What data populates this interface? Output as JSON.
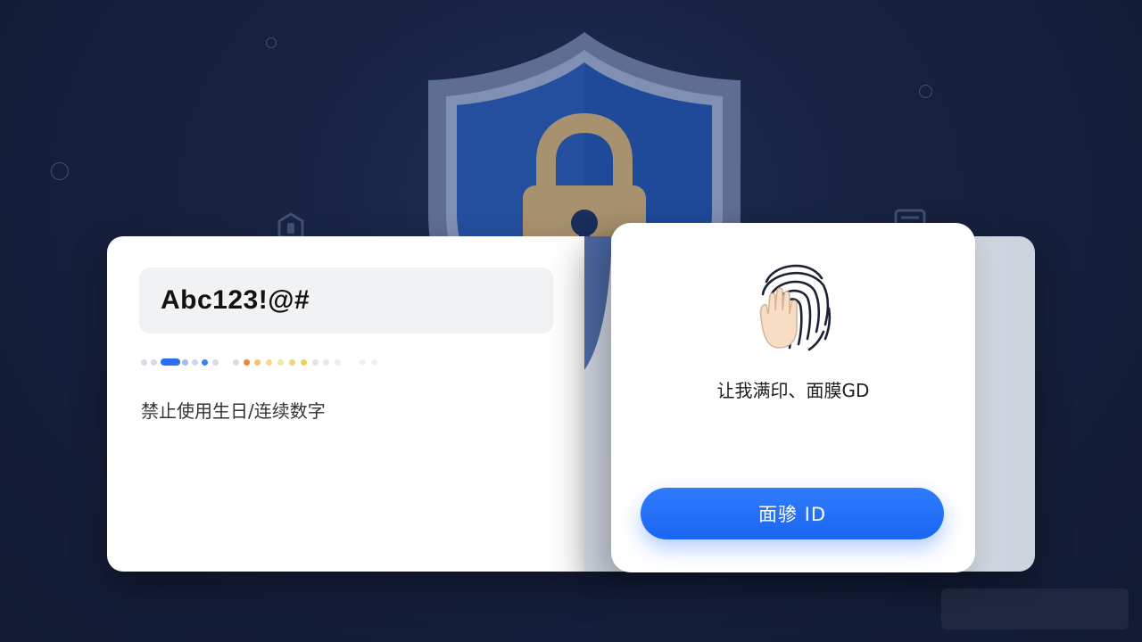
{
  "password_field": {
    "value": "Abc123!@#"
  },
  "password_rule": {
    "hint": "禁止使用生日/连续数字"
  },
  "biometric_card": {
    "caption": "让我满印、面膜GD",
    "button_label": "面骖 ID"
  },
  "colors": {
    "background": "#17213f",
    "accent_blue": "#1a66f0",
    "shield_blue": "#1f4a9a",
    "lock_gold": "#a8916f"
  },
  "icons": {
    "shield": "shield-lock-icon",
    "fingerprint": "fingerprint-hand-icon"
  }
}
